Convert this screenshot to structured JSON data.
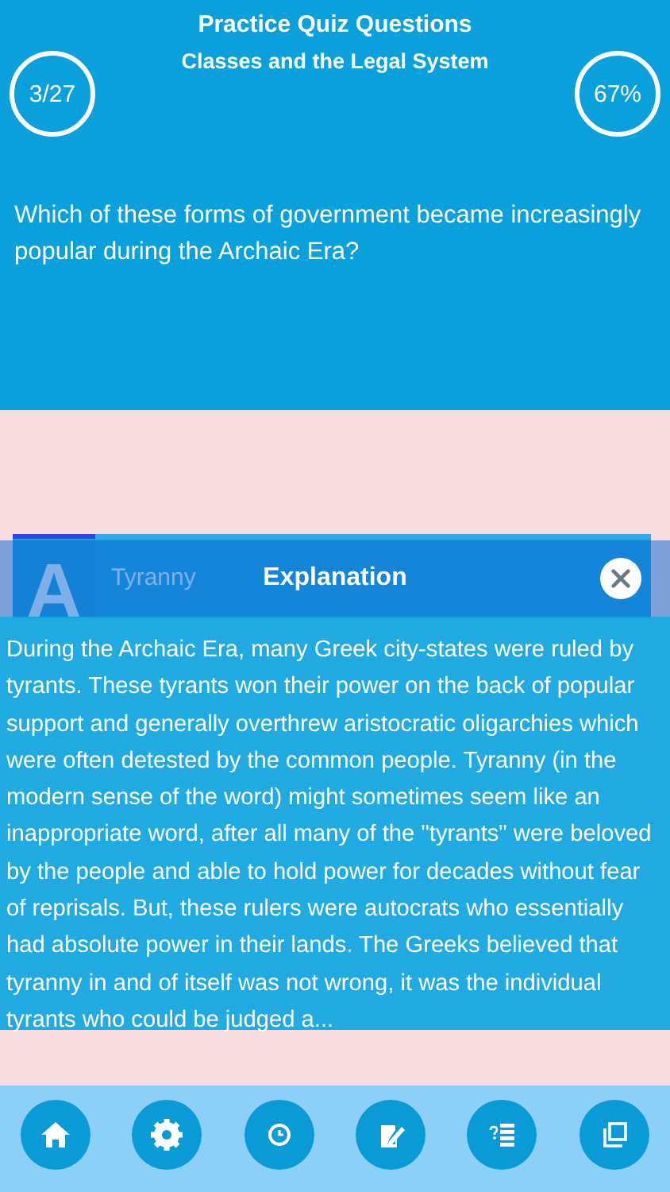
{
  "header": {
    "title": "Practice Quiz Questions",
    "subtitle": "Classes and the Legal System",
    "progress": "3/27",
    "score": "67%"
  },
  "question": {
    "text": "Which of these forms of government became increasingly popular during the Archaic Era?"
  },
  "answers": [
    {
      "letter": "A",
      "text": "Tyranny"
    }
  ],
  "explanation": {
    "title": "Explanation",
    "text": "During the Archaic Era, many Greek city-states were ruled by tyrants. These tyrants won their power on the back of popular support and generally overthrew aristocratic oligarchies which were often detested by the common people. Tyranny (in the modern sense of the word) might sometimes seem like an inappropriate word, after all many of the \"tyrants\" were beloved by the people and able to hold power for decades without fear of reprisals. But, these rulers were autocrats who essentially had absolute power in their lands. The Greeks believed that tyranny in and of itself was not wrong, it was the individual tyrants who could be judged a..."
  }
}
